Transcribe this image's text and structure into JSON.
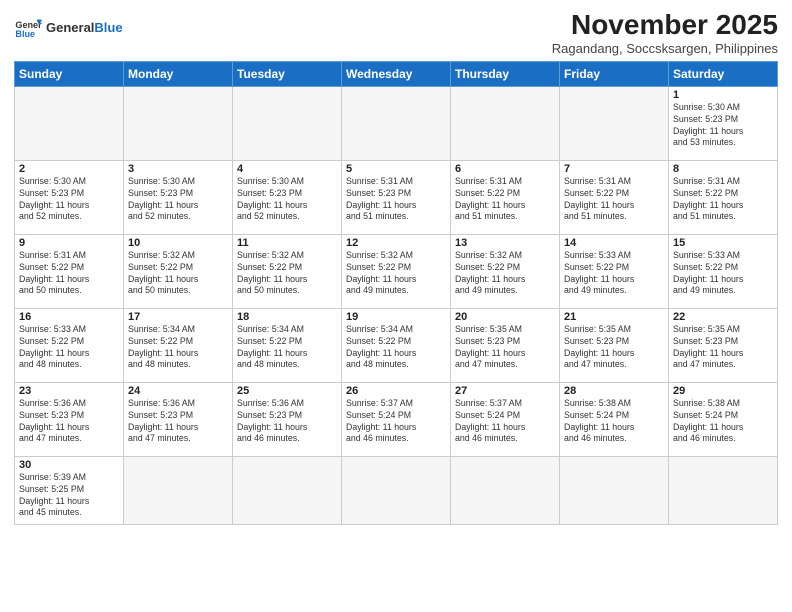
{
  "header": {
    "logo_general": "General",
    "logo_blue": "Blue",
    "month_title": "November 2025",
    "location": "Ragandang, Soccsksargen, Philippines"
  },
  "weekdays": [
    "Sunday",
    "Monday",
    "Tuesday",
    "Wednesday",
    "Thursday",
    "Friday",
    "Saturday"
  ],
  "weeks": [
    [
      {
        "day": "",
        "info": ""
      },
      {
        "day": "",
        "info": ""
      },
      {
        "day": "",
        "info": ""
      },
      {
        "day": "",
        "info": ""
      },
      {
        "day": "",
        "info": ""
      },
      {
        "day": "",
        "info": ""
      },
      {
        "day": "1",
        "info": "Sunrise: 5:30 AM\nSunset: 5:23 PM\nDaylight: 11 hours\nand 53 minutes."
      }
    ],
    [
      {
        "day": "2",
        "info": "Sunrise: 5:30 AM\nSunset: 5:23 PM\nDaylight: 11 hours\nand 52 minutes."
      },
      {
        "day": "3",
        "info": "Sunrise: 5:30 AM\nSunset: 5:23 PM\nDaylight: 11 hours\nand 52 minutes."
      },
      {
        "day": "4",
        "info": "Sunrise: 5:30 AM\nSunset: 5:23 PM\nDaylight: 11 hours\nand 52 minutes."
      },
      {
        "day": "5",
        "info": "Sunrise: 5:31 AM\nSunset: 5:23 PM\nDaylight: 11 hours\nand 51 minutes."
      },
      {
        "day": "6",
        "info": "Sunrise: 5:31 AM\nSunset: 5:22 PM\nDaylight: 11 hours\nand 51 minutes."
      },
      {
        "day": "7",
        "info": "Sunrise: 5:31 AM\nSunset: 5:22 PM\nDaylight: 11 hours\nand 51 minutes."
      },
      {
        "day": "8",
        "info": "Sunrise: 5:31 AM\nSunset: 5:22 PM\nDaylight: 11 hours\nand 51 minutes."
      }
    ],
    [
      {
        "day": "9",
        "info": "Sunrise: 5:31 AM\nSunset: 5:22 PM\nDaylight: 11 hours\nand 50 minutes."
      },
      {
        "day": "10",
        "info": "Sunrise: 5:32 AM\nSunset: 5:22 PM\nDaylight: 11 hours\nand 50 minutes."
      },
      {
        "day": "11",
        "info": "Sunrise: 5:32 AM\nSunset: 5:22 PM\nDaylight: 11 hours\nand 50 minutes."
      },
      {
        "day": "12",
        "info": "Sunrise: 5:32 AM\nSunset: 5:22 PM\nDaylight: 11 hours\nand 49 minutes."
      },
      {
        "day": "13",
        "info": "Sunrise: 5:32 AM\nSunset: 5:22 PM\nDaylight: 11 hours\nand 49 minutes."
      },
      {
        "day": "14",
        "info": "Sunrise: 5:33 AM\nSunset: 5:22 PM\nDaylight: 11 hours\nand 49 minutes."
      },
      {
        "day": "15",
        "info": "Sunrise: 5:33 AM\nSunset: 5:22 PM\nDaylight: 11 hours\nand 49 minutes."
      }
    ],
    [
      {
        "day": "16",
        "info": "Sunrise: 5:33 AM\nSunset: 5:22 PM\nDaylight: 11 hours\nand 48 minutes."
      },
      {
        "day": "17",
        "info": "Sunrise: 5:34 AM\nSunset: 5:22 PM\nDaylight: 11 hours\nand 48 minutes."
      },
      {
        "day": "18",
        "info": "Sunrise: 5:34 AM\nSunset: 5:22 PM\nDaylight: 11 hours\nand 48 minutes."
      },
      {
        "day": "19",
        "info": "Sunrise: 5:34 AM\nSunset: 5:22 PM\nDaylight: 11 hours\nand 48 minutes."
      },
      {
        "day": "20",
        "info": "Sunrise: 5:35 AM\nSunset: 5:23 PM\nDaylight: 11 hours\nand 47 minutes."
      },
      {
        "day": "21",
        "info": "Sunrise: 5:35 AM\nSunset: 5:23 PM\nDaylight: 11 hours\nand 47 minutes."
      },
      {
        "day": "22",
        "info": "Sunrise: 5:35 AM\nSunset: 5:23 PM\nDaylight: 11 hours\nand 47 minutes."
      }
    ],
    [
      {
        "day": "23",
        "info": "Sunrise: 5:36 AM\nSunset: 5:23 PM\nDaylight: 11 hours\nand 47 minutes."
      },
      {
        "day": "24",
        "info": "Sunrise: 5:36 AM\nSunset: 5:23 PM\nDaylight: 11 hours\nand 47 minutes."
      },
      {
        "day": "25",
        "info": "Sunrise: 5:36 AM\nSunset: 5:23 PM\nDaylight: 11 hours\nand 46 minutes."
      },
      {
        "day": "26",
        "info": "Sunrise: 5:37 AM\nSunset: 5:24 PM\nDaylight: 11 hours\nand 46 minutes."
      },
      {
        "day": "27",
        "info": "Sunrise: 5:37 AM\nSunset: 5:24 PM\nDaylight: 11 hours\nand 46 minutes."
      },
      {
        "day": "28",
        "info": "Sunrise: 5:38 AM\nSunset: 5:24 PM\nDaylight: 11 hours\nand 46 minutes."
      },
      {
        "day": "29",
        "info": "Sunrise: 5:38 AM\nSunset: 5:24 PM\nDaylight: 11 hours\nand 46 minutes."
      }
    ],
    [
      {
        "day": "30",
        "info": "Sunrise: 5:39 AM\nSunset: 5:25 PM\nDaylight: 11 hours\nand 45 minutes."
      },
      {
        "day": "",
        "info": ""
      },
      {
        "day": "",
        "info": ""
      },
      {
        "day": "",
        "info": ""
      },
      {
        "day": "",
        "info": ""
      },
      {
        "day": "",
        "info": ""
      },
      {
        "day": "",
        "info": ""
      }
    ]
  ]
}
